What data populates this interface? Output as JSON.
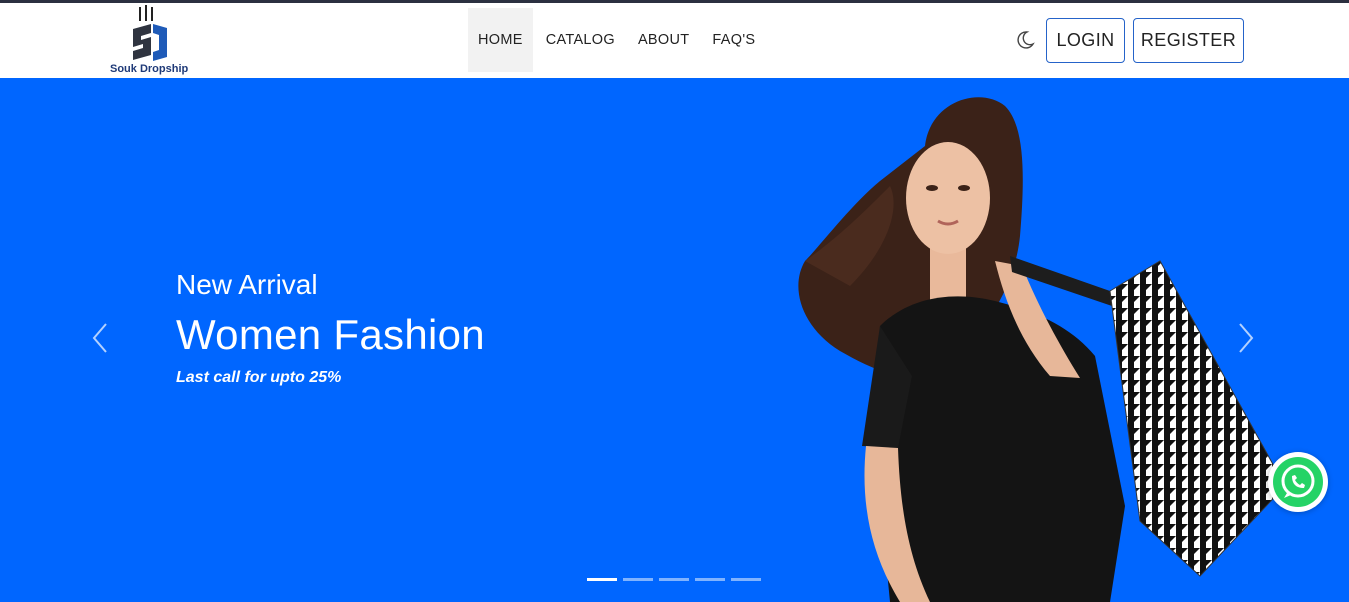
{
  "brand": {
    "name": "Souk Dropship"
  },
  "nav": {
    "items": [
      {
        "label": "HOME",
        "active": true
      },
      {
        "label": "CATALOG",
        "active": false
      },
      {
        "label": "ABOUT",
        "active": false
      },
      {
        "label": "FAQ'S",
        "active": false
      }
    ]
  },
  "header": {
    "theme_toggle_icon": "moon-icon",
    "login_label": "LOGIN",
    "register_label": "REGISTER"
  },
  "hero": {
    "subtitle": "New Arrival",
    "title": "Women Fashion",
    "note": "Last call for upto 25%",
    "background_color": "#0066ff",
    "slide_count": 5,
    "active_slide": 1
  },
  "floating": {
    "whatsapp_icon": "whatsapp-icon",
    "whatsapp_color": "#25d366"
  },
  "colors": {
    "accent": "#2563c9",
    "hero": "#0066ff",
    "topline": "#2b3040"
  }
}
